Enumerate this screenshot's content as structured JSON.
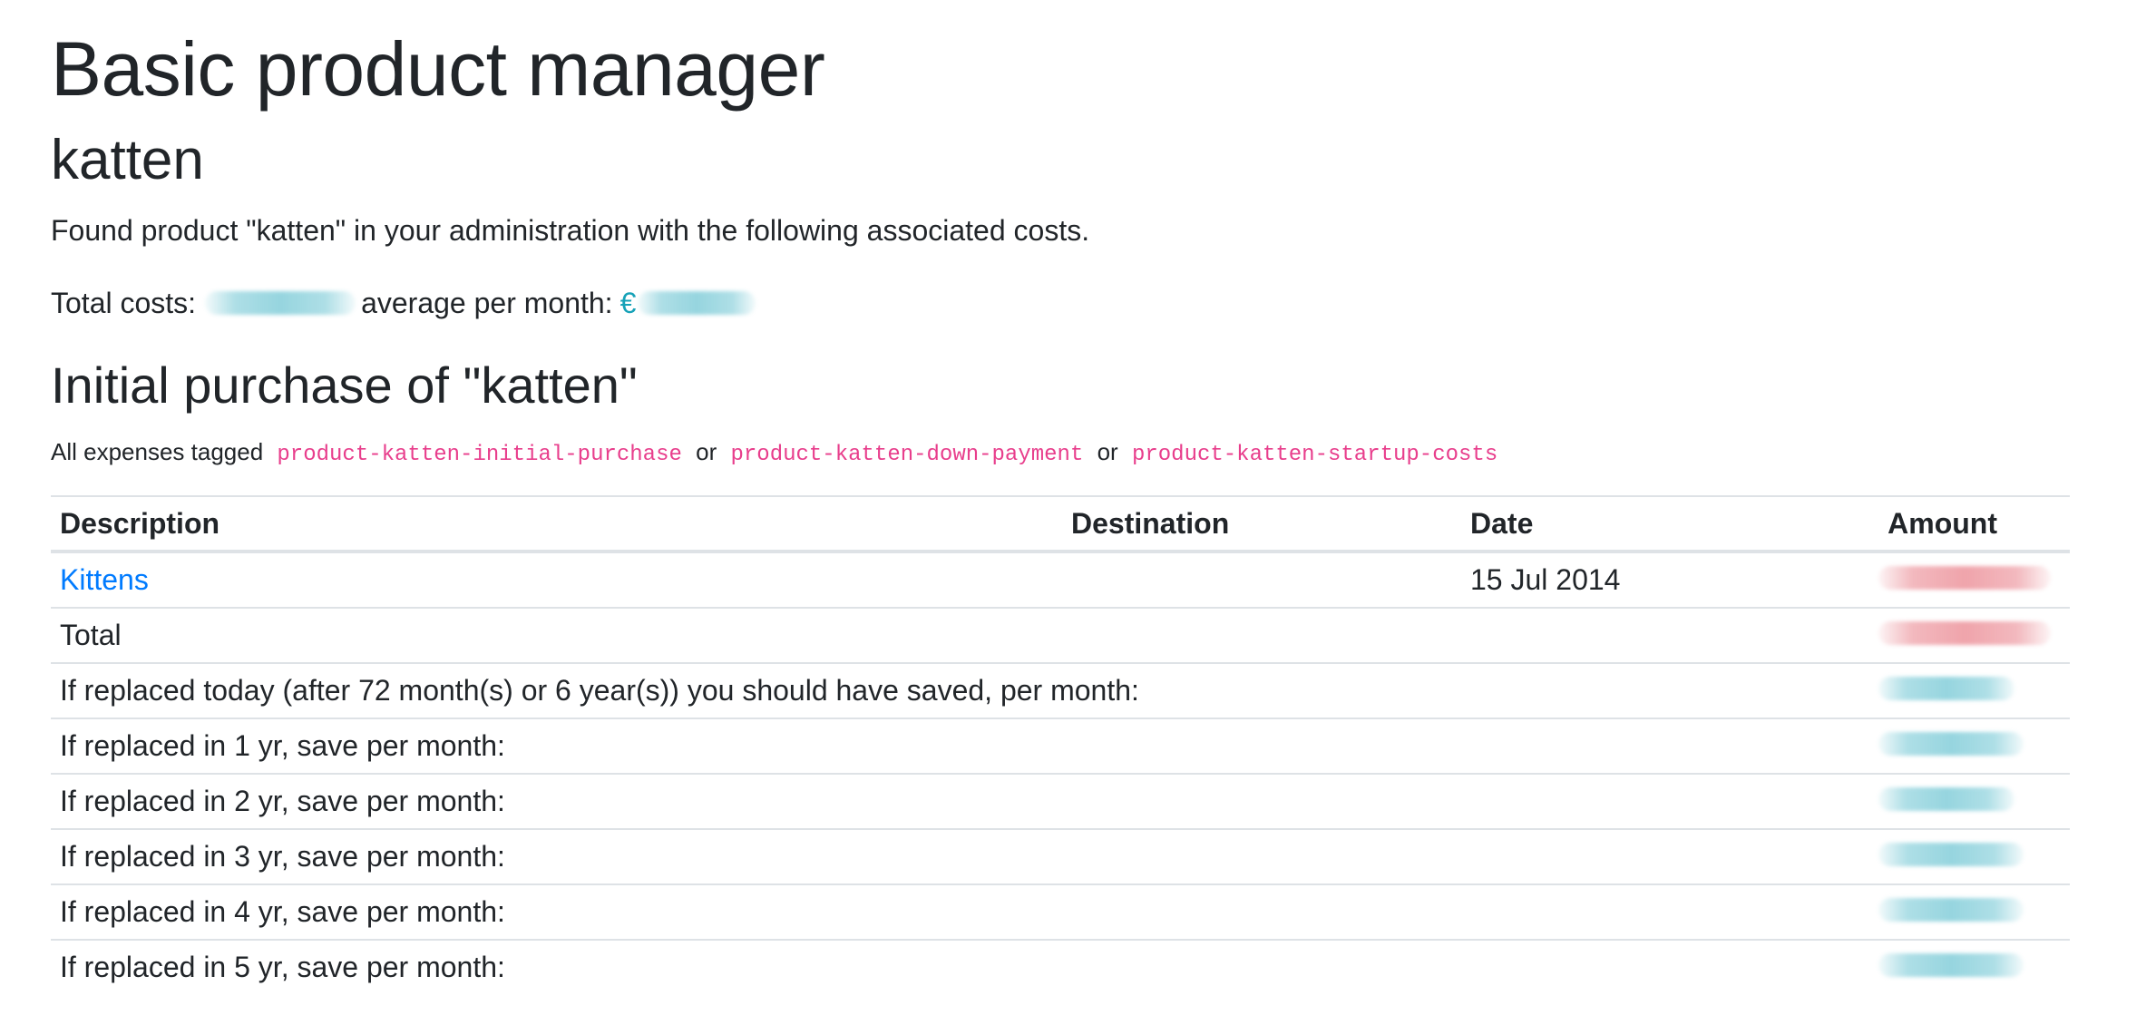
{
  "page": {
    "title": "Basic product manager",
    "product_name": "katten",
    "found_text": "Found product \"katten\" in your administration with the following associated costs.",
    "total_costs_label": "Total costs:",
    "average_label": "average per month:",
    "currency_symbol": "€"
  },
  "initial_purchase": {
    "heading": "Initial purchase of \"katten\"",
    "tags_intro": "All expenses tagged",
    "tags": [
      "product-katten-initial-purchase",
      "product-katten-down-payment",
      "product-katten-startup-costs"
    ],
    "or_word": "or",
    "columns": [
      "Description",
      "Destination",
      "Date",
      "Amount"
    ],
    "rows": [
      {
        "description": "Kittens",
        "destination": "",
        "date": "15 Jul 2014"
      },
      {
        "description": "Total",
        "destination": "",
        "date": ""
      },
      {
        "description": "If replaced today (after 72 month(s) or 6 year(s)) you should have saved, per month:",
        "destination": "",
        "date": ""
      },
      {
        "description": "If replaced in 1 yr, save per month:",
        "destination": "",
        "date": ""
      },
      {
        "description": "If replaced in 2 yr, save per month:",
        "destination": "",
        "date": ""
      },
      {
        "description": "If replaced in 3 yr, save per month:",
        "destination": "",
        "date": ""
      },
      {
        "description": "If replaced in 4 yr, save per month:",
        "destination": "",
        "date": ""
      },
      {
        "description": "If replaced in 5 yr, save per month:",
        "destination": "",
        "date": ""
      }
    ]
  },
  "colors": {
    "text": "#212529",
    "link": "#007bff",
    "tag": "#e83e8c",
    "positive_amount": "#17a2b8",
    "negative_amount": "#dc3545"
  }
}
